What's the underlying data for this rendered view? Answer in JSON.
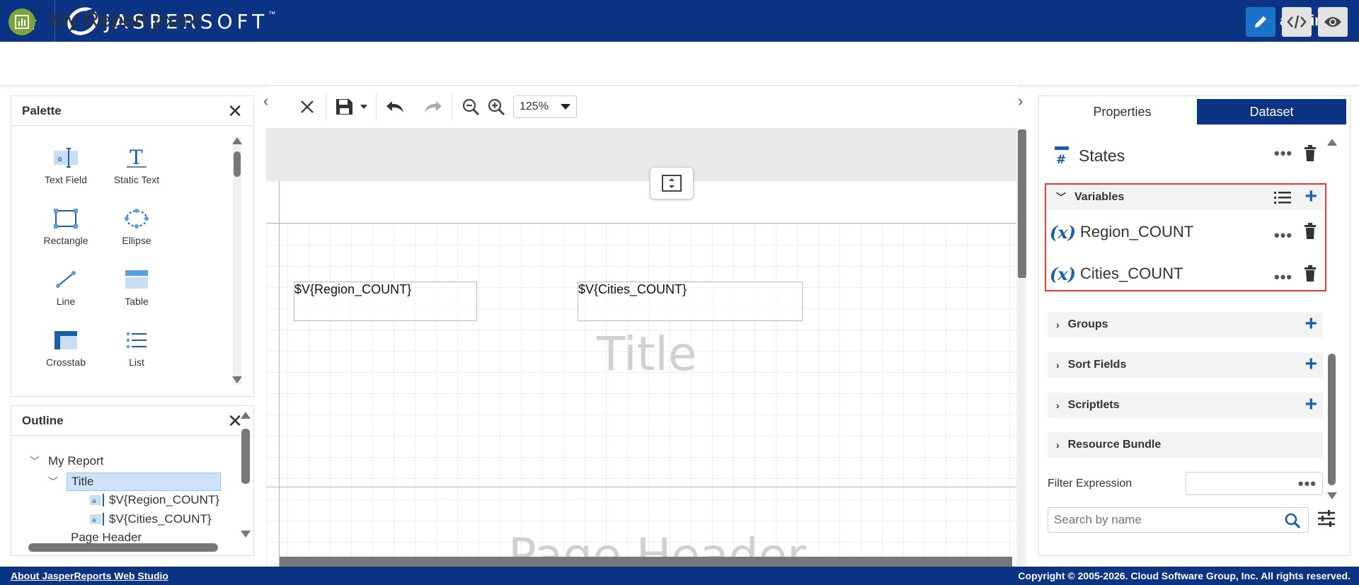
{
  "header": {
    "brand": "JASPERSOFT",
    "brand_tm": "™",
    "user": "admin"
  },
  "titlebar": {
    "report_title": "My Report.jrxml"
  },
  "palette": {
    "title": "Palette",
    "items": [
      {
        "label": "Text Field"
      },
      {
        "label": "Static Text"
      },
      {
        "label": "Rectangle"
      },
      {
        "label": "Ellipse"
      },
      {
        "label": "Line"
      },
      {
        "label": "Table"
      },
      {
        "label": "Crosstab"
      },
      {
        "label": "List"
      }
    ]
  },
  "outline": {
    "title": "Outline",
    "root": "My Report",
    "title_node": "Title",
    "children": [
      "$V{Region_COUNT}",
      "$V{Cities_COUNT}"
    ],
    "next": "Page Header"
  },
  "canvas": {
    "zoom": "125%",
    "fields": [
      "$V{Region_COUNT}",
      "$V{Cities_COUNT}"
    ],
    "band_title": "Title",
    "band_page_header": "Page Header"
  },
  "rightpanel": {
    "tabs": [
      "Properties",
      "Dataset"
    ],
    "dataset_name": "States",
    "sections": {
      "variables": "Variables",
      "groups": "Groups",
      "sort_fields": "Sort Fields",
      "scriptlets": "Scriptlets",
      "resource_bundle": "Resource Bundle"
    },
    "variables": [
      "Region_COUNT",
      "Cities_COUNT"
    ],
    "variable_icon": "(x)",
    "filter_label": "Filter Expression",
    "search_placeholder": "Search by name"
  },
  "footer": {
    "about": "About JasperReports Web Studio",
    "copyright": "Copyright © 2005-2026. Cloud Software Group, Inc. All rights reserved."
  },
  "colors": {
    "brand_navy": "#0b3384",
    "accent_blue": "#1a73c8",
    "highlight_red": "#e03c3c"
  }
}
